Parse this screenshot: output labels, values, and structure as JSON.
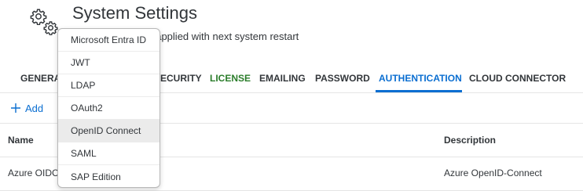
{
  "header": {
    "title": "System Settings",
    "subtitle": "s, changes will be applied with next system restart"
  },
  "tabs": [
    {
      "label": "GENERA"
    },
    {
      "label": "ECURITY"
    },
    {
      "label": "LICENSE"
    },
    {
      "label": "EMAILING"
    },
    {
      "label": "PASSWORD"
    },
    {
      "label": "AUTHENTICATION",
      "active": true
    },
    {
      "label": "CLOUD CONNECTOR"
    }
  ],
  "toolbar": {
    "add_label": "Add"
  },
  "table": {
    "columns": [
      "Name",
      "Description"
    ],
    "rows": [
      {
        "name": "Azure OIDC",
        "description": "Azure OpenID-Connect"
      }
    ]
  },
  "dropdown": {
    "items": [
      "Microsoft Entra ID",
      "JWT",
      "LDAP",
      "OAuth2",
      "OpenID Connect",
      "SAML",
      "SAP Edition"
    ],
    "hovered": "OpenID Connect"
  },
  "colors": {
    "accent": "#0a6ed1",
    "license": "#2b7d2b",
    "text": "#32363a"
  }
}
